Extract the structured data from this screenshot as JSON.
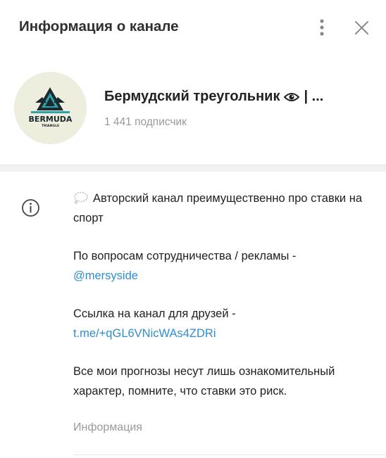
{
  "header": {
    "title": "Информация о канале",
    "menu_icon": "kebab-menu-icon",
    "close_icon": "close-icon"
  },
  "channel": {
    "logo_text": "BERMUDA",
    "logo_subtext": "TRIANGLE",
    "name": "Бермудский треугольник",
    "name_tail": "| ...",
    "subscribers": "1 441 подписчик"
  },
  "info": {
    "line1": "Авторский канал преимущественно про ставки на спорт",
    "line2": "По вопросам сотрудничества / рекламы -",
    "link1": "@mersyside",
    "line3": "Ссылка на канал для друзей -",
    "link2": "t.me/+qGL6VNicWAs4ZDRi",
    "line4": "Все мои прогнозы несут лишь ознакомительный характер, помните, что ставки это риск.",
    "caption": "Информация"
  },
  "colors": {
    "accent_link": "#2e8dcf",
    "secondary_text": "#999999",
    "avatar_bg": "#eeeedf",
    "logo_teal": "#2aa3a8",
    "logo_dark": "#1c2a30"
  }
}
